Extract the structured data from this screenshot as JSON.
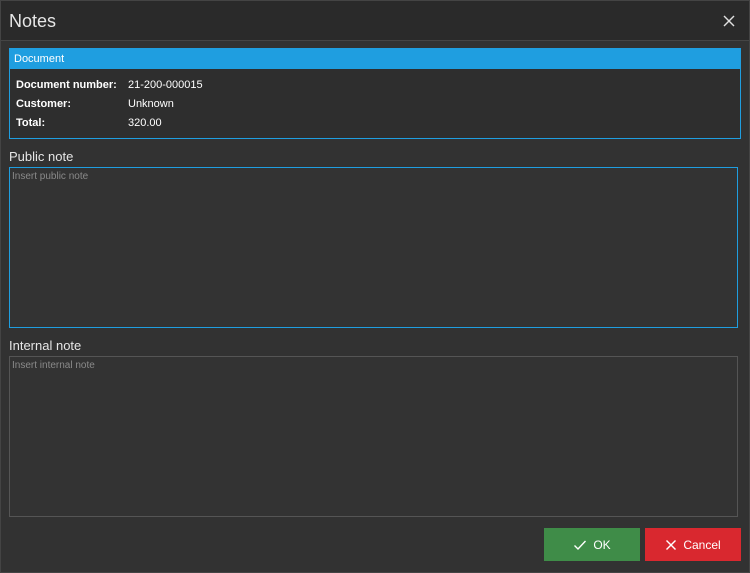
{
  "window": {
    "title": "Notes"
  },
  "document_panel": {
    "header": "Document",
    "fields": [
      {
        "label": "Document number:",
        "value": "21-200-000015"
      },
      {
        "label": "Customer:",
        "value": "Unknown"
      },
      {
        "label": "Total:",
        "value": "320.00"
      }
    ]
  },
  "public_note": {
    "label": "Public note",
    "placeholder": "Insert public note",
    "value": ""
  },
  "internal_note": {
    "label": "Internal note",
    "placeholder": "Insert internal note",
    "value": ""
  },
  "buttons": {
    "ok_label": "OK",
    "cancel_label": "Cancel"
  },
  "icons": {
    "close": "close-icon",
    "ok": "checkmark-icon",
    "cancel": "cancel-x-icon"
  },
  "colors": {
    "accent": "#1f9ee0",
    "ok": "#3f8c48",
    "cancel": "#d9282f",
    "background": "#323232"
  }
}
